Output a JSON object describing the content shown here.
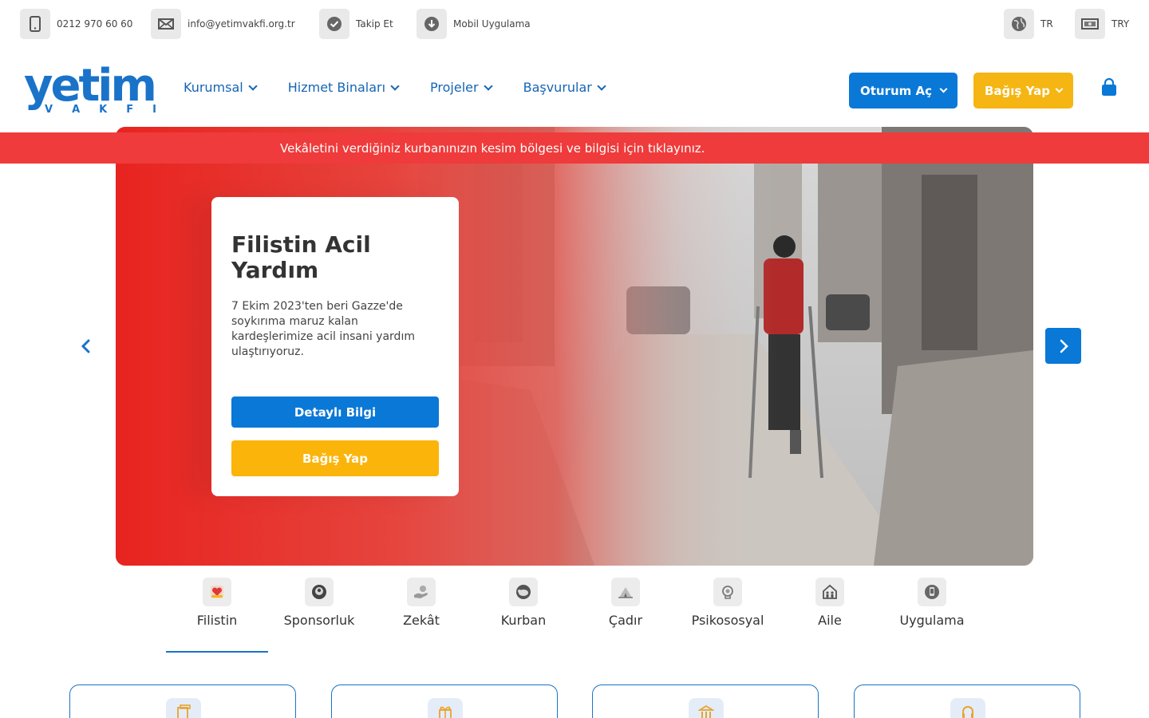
{
  "topbar": {
    "phone": "0212 970 60 60",
    "email": "info@yetimvakfi.org.tr",
    "follow": "Takip Et",
    "app": "Mobil Uygulama",
    "language": "TR",
    "currency": "TRY"
  },
  "header": {
    "logo_main": "yetim",
    "logo_sub": [
      "V",
      "A",
      "K",
      "F",
      "I"
    ],
    "nav": [
      "Kurumsal",
      "Hizmet Binaları",
      "Projeler",
      "Başvurular"
    ],
    "login_label": "Oturum Aç",
    "donate_label": "Bağış Yap"
  },
  "alert": {
    "text": "Vekâletini verdiğiniz kurbanınızın kesim bölgesi ve bilgisi için tıklayınız."
  },
  "hero": {
    "title": "Filistin Acil Yardım",
    "description": "7 Ekim 2023'ten beri Gazze'de soykırıma maruz kalan kardeşlerimize acil insani yardım ulaştırıyoruz.",
    "details_label": "Detaylı Bilgi",
    "donate_label": "Bağış Yap"
  },
  "categories": {
    "active_index": 0,
    "items": [
      {
        "label": "Filistin",
        "icon": "heart-hand-icon"
      },
      {
        "label": "Sponsorluk",
        "icon": "child-face-icon"
      },
      {
        "label": "Zekât",
        "icon": "hand-giving-icon"
      },
      {
        "label": "Kurban",
        "icon": "sheep-icon"
      },
      {
        "label": "Çadır",
        "icon": "tent-icon"
      },
      {
        "label": "Psikososyal",
        "icon": "brain-icon"
      },
      {
        "label": "Aile",
        "icon": "family-house-icon"
      },
      {
        "label": "Uygulama",
        "icon": "phone-app-icon"
      }
    ]
  },
  "colors": {
    "primary": "#0a78d6",
    "accent": "#f5b512",
    "alert": "#ef3b3b",
    "nav_text": "#1565b5"
  }
}
